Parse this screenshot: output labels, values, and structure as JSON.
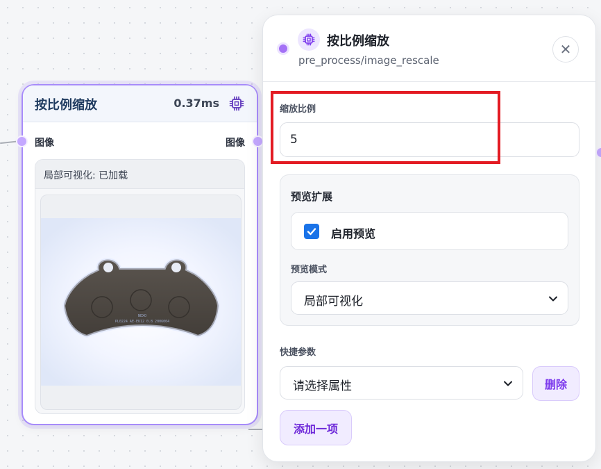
{
  "colors": {
    "accent": "#a78bfa",
    "port": "#c4a8ff",
    "checkbox": "#1a73e8",
    "button_bg": "#f1ecff",
    "button_text": "#7c3aed",
    "highlight": "#e31b23"
  },
  "node": {
    "title": "按比例缩放",
    "time": "0.37ms",
    "icon": "chip-icon",
    "input_port_label": "图像",
    "output_port_label": "图像",
    "preview_label": "局部可视化: 已加载",
    "image_text_line1": "NEXO",
    "image_text_line2": "PL0224 AE-EU12 0.8 2006004"
  },
  "panel": {
    "title": "按比例缩放",
    "path": "pre_process/image_rescale",
    "icon": "chip-icon",
    "close_icon": "close-icon",
    "close_symbol": "✕",
    "scale_label": "缩放比例",
    "scale_value": "5",
    "preview_section_title": "预览扩展",
    "enable_preview_label": "启用预览",
    "enable_preview_checked": true,
    "preview_mode_label": "预览模式",
    "preview_mode_value": "局部可视化",
    "quick_params_label": "快捷参数",
    "attribute_placeholder": "请选择属性",
    "delete_label": "删除",
    "add_label": "添加一项"
  }
}
